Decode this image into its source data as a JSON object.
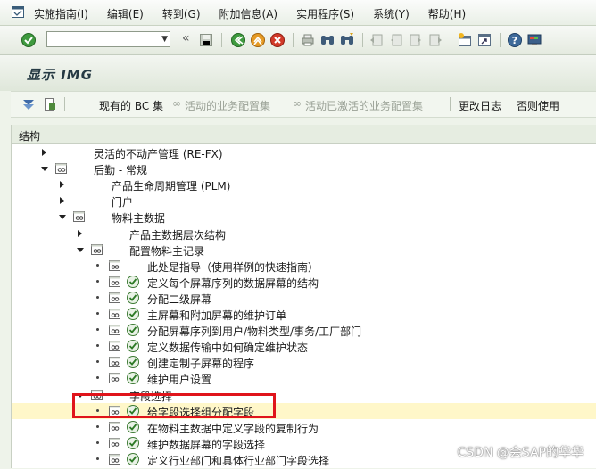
{
  "menubar": {
    "items": [
      "实施指南(I)",
      "编辑(E)",
      "转到(G)",
      "附加信息(A)",
      "实用程序(S)",
      "系统(Y)",
      "帮助(H)"
    ]
  },
  "toolbar": {
    "command_value": "",
    "icons": [
      "check-icon",
      "back-icon",
      "save-icon",
      "back-green-icon",
      "exit-icon",
      "cancel-icon",
      "print-icon",
      "find-icon",
      "find-next-icon",
      "first-page-icon",
      "prev-page-icon",
      "next-page-icon",
      "last-page-icon",
      "new-session-icon",
      "shortcut-icon",
      "help-icon",
      "customize-layout-icon"
    ]
  },
  "title": "显示 IMG",
  "apptoolbar": {
    "existing_bc_sets": "现有的 BC 集",
    "active_bc_sets": "活动的业务配置集",
    "activated_bc_sets": "活动已激活的业务配置集",
    "change_log": "更改日志",
    "use_or_not": "否则使用"
  },
  "structure_header": "结构",
  "tree": [
    {
      "label": "灵活的不动产管理 (RE-FX)",
      "state": "collapsed",
      "icon": false,
      "exec": false
    },
    {
      "label": "后勤 - 常规",
      "state": "expanded",
      "icon": true,
      "exec": false
    },
    {
      "label": "产品生命周期管理 (PLM)",
      "state": "collapsed",
      "icon": false,
      "exec": false
    },
    {
      "label": "门户",
      "state": "collapsed",
      "icon": false,
      "exec": false
    },
    {
      "label": "物料主数据",
      "state": "expanded",
      "icon": true,
      "exec": false
    },
    {
      "label": "产品主数据层次结构",
      "state": "collapsed",
      "icon": false,
      "exec": false
    },
    {
      "label": "配置物料主记录",
      "state": "expanded",
      "icon": true,
      "exec": false
    },
    {
      "label": "此处是指导（使用样例的快速指南）",
      "state": "leaf",
      "icon": true,
      "exec": false
    },
    {
      "label": "定义每个屏幕序列的数据屏幕的结构",
      "state": "leaf",
      "icon": true,
      "exec": true
    },
    {
      "label": "分配二级屏幕",
      "state": "leaf",
      "icon": true,
      "exec": true
    },
    {
      "label": "主屏幕和附加屏幕的维护订单",
      "state": "leaf",
      "icon": true,
      "exec": true
    },
    {
      "label": "分配屏幕序列到用户/物料类型/事务/工厂部门",
      "state": "leaf",
      "icon": true,
      "exec": true
    },
    {
      "label": "定义数据传输中如何确定维护状态",
      "state": "leaf",
      "icon": true,
      "exec": true
    },
    {
      "label": "创建定制子屏幕的程序",
      "state": "leaf",
      "icon": true,
      "exec": true
    },
    {
      "label": "维护用户设置",
      "state": "leaf",
      "icon": true,
      "exec": true
    },
    {
      "label": "字段选择",
      "state": "expanded",
      "icon": true,
      "exec": false
    },
    {
      "label": "给字段选择组分配字段",
      "state": "leaf",
      "icon": true,
      "exec": true,
      "selected": true
    },
    {
      "label": "在物料主数据中定义字段的复制行为",
      "state": "leaf",
      "icon": true,
      "exec": true
    },
    {
      "label": "维护数据屏幕的字段选择",
      "state": "leaf",
      "icon": true,
      "exec": true
    },
    {
      "label": "定义行业部门和具体行业部门字段选择",
      "state": "leaf",
      "icon": true,
      "exec": true
    }
  ],
  "watermark": "CSDN @会SAP的华华"
}
